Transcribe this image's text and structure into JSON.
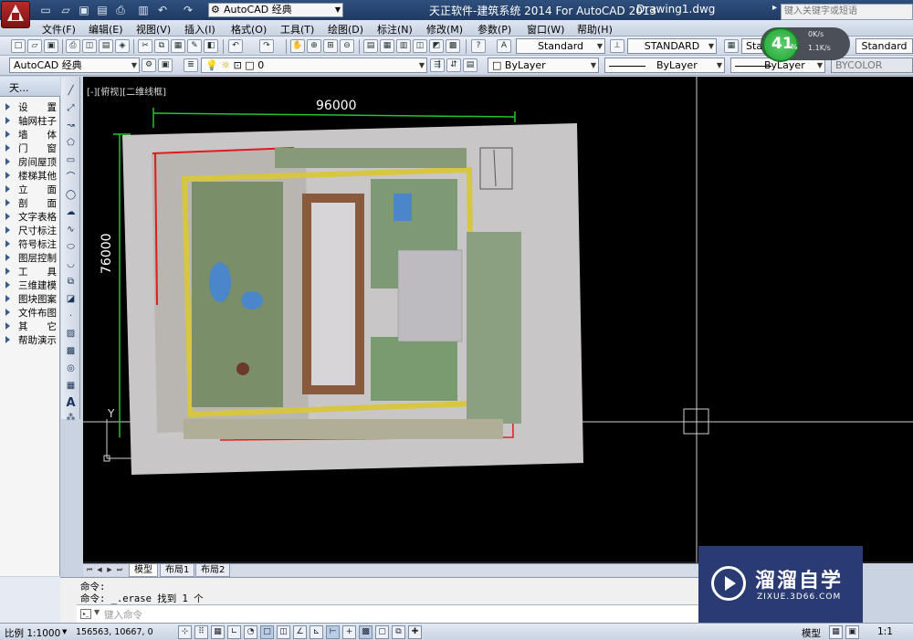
{
  "titlebar": {
    "workspace": "AutoCAD 经典",
    "title": "天正软件-建筑系统 2014  For AutoCAD 2013",
    "document": "Drawing1.dwg",
    "search_placeholder": "键入关键字或短语"
  },
  "menu": [
    "文件(F)",
    "编辑(E)",
    "视图(V)",
    "插入(I)",
    "格式(O)",
    "工具(T)",
    "绘图(D)",
    "标注(N)",
    "修改(M)",
    "参数(P)",
    "窗口(W)",
    "帮助(H)"
  ],
  "toolbar1": {
    "text_style": "Standard",
    "dim_style": "STANDARD",
    "table_style": "Standard",
    "multileader_style": "Standard"
  },
  "toolbar2": {
    "workspace": "AutoCAD 经典",
    "layer": "0",
    "color": "ByLayer",
    "linetype": "ByLayer",
    "lineweight": "ByLayer",
    "plotstyle": "BYCOLOR"
  },
  "net_widget": {
    "value": "41",
    "unit": "%",
    "up": "0K/s",
    "down": "1.1K/s"
  },
  "tz_panel": {
    "title": "天...",
    "items": [
      "设　　置",
      "轴网柱子",
      "墙　　体",
      "门　　窗",
      "房间屋顶",
      "楼梯其他",
      "立　　面",
      "剖　　面",
      "文字表格",
      "尺寸标注",
      "符号标注",
      "图层控制",
      "工　　具",
      "三维建模",
      "图块图案",
      "文件布图",
      "其　　它",
      "帮助演示"
    ]
  },
  "canvas": {
    "view_label": "[-][俯视][二维线框]",
    "dim_horizontal": "96000",
    "dim_vertical": "76000",
    "ucs_y": "Y"
  },
  "layout_tabs": [
    "模型",
    "布局1",
    "布局2"
  ],
  "command": {
    "line1": "命令:",
    "line2": "命令: _.erase 找到 1 个",
    "placeholder": "键入命令"
  },
  "status": {
    "scale": "比例 1:1000",
    "coords": "156563, 10667, 0",
    "model": "模型",
    "anno_scale": "1:1"
  },
  "watermark": {
    "title": "溜溜自学",
    "url": "ZIXUE.3D66.COM"
  },
  "colors": {
    "accent": "#2a3a73",
    "dimension": "#22c52b",
    "titlebar": "#2f4f7d"
  }
}
